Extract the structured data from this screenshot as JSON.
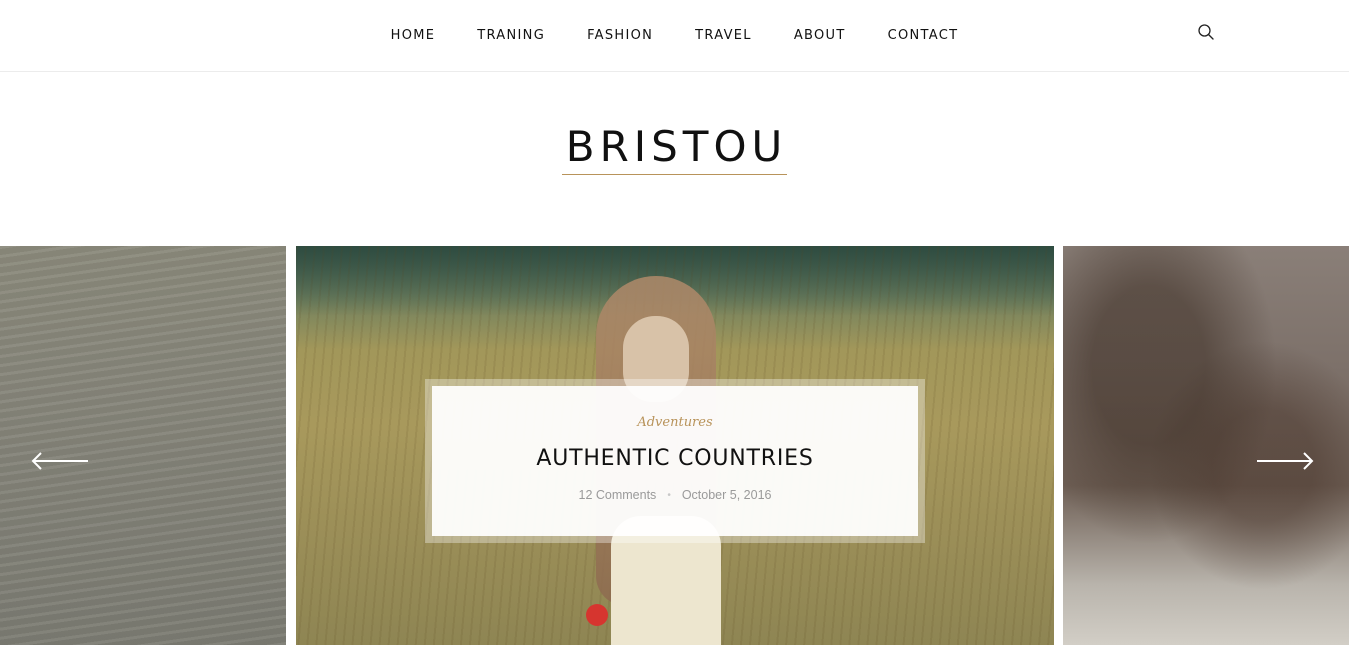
{
  "nav": {
    "items": [
      {
        "label": "HOME"
      },
      {
        "label": "TRANING"
      },
      {
        "label": "FASHION"
      },
      {
        "label": "TRAVEL"
      },
      {
        "label": "ABOUT"
      },
      {
        "label": "CONTACT"
      }
    ],
    "search_icon": "search-icon"
  },
  "site": {
    "logo": "BRISTOU",
    "accent_color": "#b8935a"
  },
  "slider": {
    "prev_icon": "arrow-left-icon",
    "next_icon": "arrow-right-icon",
    "current": {
      "category": "Adventures",
      "title": "AUTHENTIC COUNTRIES",
      "comments": "12 Comments",
      "separator": "•",
      "date": "October 5, 2016"
    }
  }
}
